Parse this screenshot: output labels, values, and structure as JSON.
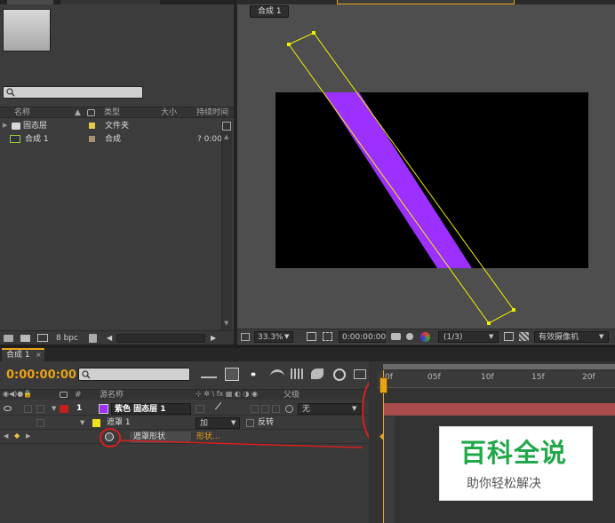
{
  "project": {
    "search_placeholder": "",
    "columns": {
      "name": "名称",
      "type": "类型",
      "size": "大小",
      "duration": "持续时间"
    },
    "items": [
      {
        "name": "固态层",
        "type": "文件夹",
        "duration": "",
        "label_color": "#e8c84a"
      },
      {
        "name": "合成 1",
        "type": "合成",
        "duration": "? 0:00",
        "label_color": "#a89070"
      }
    ],
    "bpc": "8 bpc"
  },
  "viewer": {
    "comp_tab": "合成 1",
    "zoom": "33.3%",
    "timecode": "0:00:00:00",
    "resolution": "(1/3)",
    "camera": "有效摄像机"
  },
  "timeline": {
    "tab": "合成 1",
    "timecode": "0:00:00:00",
    "search_placeholder": "",
    "col_source": "源名称",
    "col_parent": "父级",
    "col_num": "#",
    "layer": {
      "num": "1",
      "name": "紫色 固态层 1",
      "parent": "无",
      "label_color": "#9b30ff"
    },
    "mask": {
      "name": "遮罩 1",
      "mode": "加",
      "invert": "反转",
      "label_color": "#f0e020"
    },
    "mask_shape": {
      "name": "遮罩形状",
      "value": "形状..."
    },
    "ruler": [
      "0f",
      "05f",
      "10f",
      "15f",
      "20f"
    ]
  },
  "watermark": {
    "title": "百科全说",
    "subtitle": "助你轻松解决"
  },
  "colors": {
    "accent_orange": "#e8a317",
    "mask_yellow": "#f0f000",
    "solid_purple": "#9b30ff",
    "annotation_red": "#d81e1e"
  }
}
